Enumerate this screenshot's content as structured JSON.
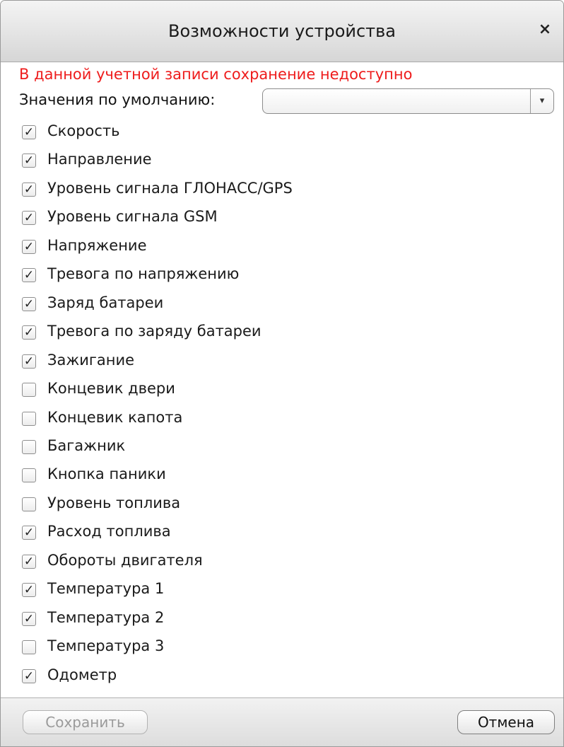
{
  "dialog": {
    "title": "Возможности устройства",
    "close_glyph": "×",
    "warning": "В данной учетной записи сохранение недоступно",
    "defaults_label": "Значения по умолчанию:",
    "defaults_value": "",
    "dropdown_glyph": "▾",
    "check_glyph": "✓",
    "items": [
      {
        "label": "Скорость",
        "checked": true
      },
      {
        "label": "Направление",
        "checked": true
      },
      {
        "label": "Уровень сигнала ГЛОНАСС/GPS",
        "checked": true
      },
      {
        "label": "Уровень сигнала GSM",
        "checked": true
      },
      {
        "label": "Напряжение",
        "checked": true
      },
      {
        "label": "Тревога по напряжению",
        "checked": true
      },
      {
        "label": "Заряд батареи",
        "checked": true
      },
      {
        "label": "Тревога по заряду батареи",
        "checked": true
      },
      {
        "label": "Зажигание",
        "checked": true
      },
      {
        "label": "Концевик двери",
        "checked": false
      },
      {
        "label": "Концевик капота",
        "checked": false
      },
      {
        "label": "Багажник",
        "checked": false
      },
      {
        "label": "Кнопка паники",
        "checked": false
      },
      {
        "label": "Уровень топлива",
        "checked": false
      },
      {
        "label": "Расход топлива",
        "checked": true
      },
      {
        "label": "Обороты двигателя",
        "checked": true
      },
      {
        "label": "Температура 1",
        "checked": true
      },
      {
        "label": "Температура 2",
        "checked": true
      },
      {
        "label": "Температура 3",
        "checked": false
      },
      {
        "label": "Одометр",
        "checked": true
      }
    ],
    "save_label": "Сохранить",
    "save_enabled": false,
    "cancel_label": "Отмена"
  },
  "colors": {
    "warning": "#ee1c1c",
    "disabled_text": "#9a9a9a"
  }
}
